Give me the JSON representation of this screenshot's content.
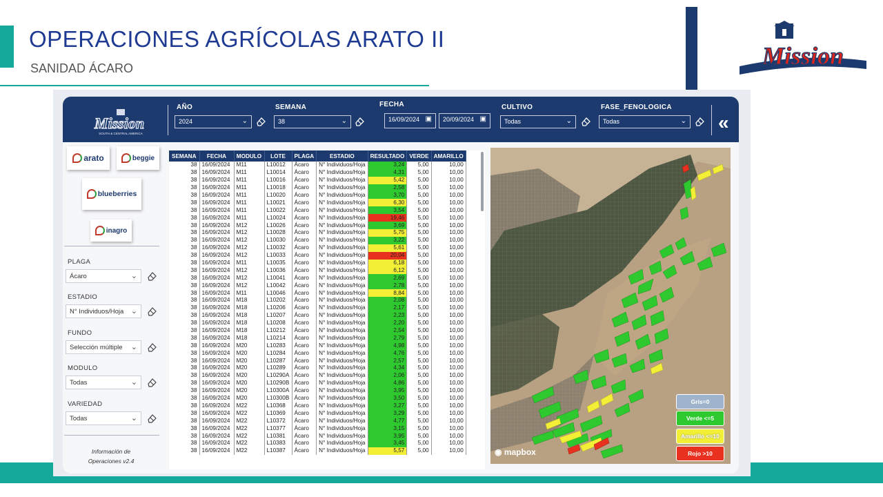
{
  "slide": {
    "title": "OPERACIONES AGRÍCOLAS ARATO II",
    "subtitle": "SANIDAD ÁCARO",
    "logo_text": "Mission",
    "colors": {
      "accent": "#14a99a",
      "title": "#1f3a93",
      "header": "#1d3a6e"
    }
  },
  "header": {
    "logo_text": "Mission",
    "logo_sub": "SOUTH & CENTRAL AMERICA",
    "filters": {
      "anio": {
        "label": "AÑO",
        "value": "2024"
      },
      "semana": {
        "label": "SEMANA",
        "value": "38"
      },
      "fecha": {
        "label": "FECHA",
        "from": "16/09/2024",
        "to": "20/09/2024"
      },
      "cultivo": {
        "label": "CULTIVO",
        "value": "Todas"
      },
      "fase": {
        "label": "FASE_FENOLOGICA",
        "value": "Todas"
      }
    },
    "collapse_icon": "«"
  },
  "left_panel": {
    "brands": [
      "arato",
      "beggie",
      "blueberries",
      "inagro"
    ],
    "filters": [
      {
        "label": "PLAGA",
        "value": "Ácaro"
      },
      {
        "label": "ESTADIO",
        "value": "N° Individuos/Hoja"
      },
      {
        "label": "FUNDO",
        "value": "Selección múltiple"
      },
      {
        "label": "MODULO",
        "value": "Todas"
      },
      {
        "label": "VARIEDAD",
        "value": "Todas"
      }
    ],
    "info_line1": "Información de",
    "info_line2": "Operaciones v2.4"
  },
  "table": {
    "columns": [
      "SEMANA",
      "FECHA",
      "MODULO",
      "LOTE",
      "PLAGA",
      "ESTADIO",
      "RESULTADO",
      "VERDE",
      "AMARILLO"
    ],
    "rows": [
      [
        "38",
        "16/09/2024",
        "M11",
        "L10012",
        "Ácaro",
        "N° Individuos/Hoja",
        "3,24",
        "5,00",
        "10,00",
        "g"
      ],
      [
        "38",
        "16/09/2024",
        "M11",
        "L10014",
        "Ácaro",
        "N° Individuos/Hoja",
        "4,31",
        "5,00",
        "10,00",
        "g"
      ],
      [
        "38",
        "16/09/2024",
        "M11",
        "L10016",
        "Ácaro",
        "N° Individuos/Hoja",
        "5,42",
        "5,00",
        "10,00",
        "y"
      ],
      [
        "38",
        "16/09/2024",
        "M11",
        "L10018",
        "Ácaro",
        "N° Individuos/Hoja",
        "2,58",
        "5,00",
        "10,00",
        "g"
      ],
      [
        "38",
        "16/09/2024",
        "M11",
        "L10020",
        "Ácaro",
        "N° Individuos/Hoja",
        "3,70",
        "5,00",
        "10,00",
        "g"
      ],
      [
        "38",
        "16/09/2024",
        "M11",
        "L10021",
        "Ácaro",
        "N° Individuos/Hoja",
        "6,30",
        "5,00",
        "10,00",
        "y"
      ],
      [
        "38",
        "16/09/2024",
        "M11",
        "L10022",
        "Ácaro",
        "N° Individuos/Hoja",
        "3,54",
        "5,00",
        "10,00",
        "g"
      ],
      [
        "38",
        "16/09/2024",
        "M11",
        "L10024",
        "Ácaro",
        "N° Individuos/Hoja",
        "19,46",
        "5,00",
        "10,00",
        "r"
      ],
      [
        "38",
        "16/09/2024",
        "M12",
        "L10026",
        "Ácaro",
        "N° Individuos/Hoja",
        "3,69",
        "5,00",
        "10,00",
        "g"
      ],
      [
        "38",
        "16/09/2024",
        "M12",
        "L10028",
        "Ácaro",
        "N° Individuos/Hoja",
        "5,75",
        "5,00",
        "10,00",
        "y"
      ],
      [
        "38",
        "16/09/2024",
        "M12",
        "L10030",
        "Ácaro",
        "N° Individuos/Hoja",
        "3,22",
        "5,00",
        "10,00",
        "g"
      ],
      [
        "38",
        "16/09/2024",
        "M12",
        "L10032",
        "Ácaro",
        "N° Individuos/Hoja",
        "5,61",
        "5,00",
        "10,00",
        "y"
      ],
      [
        "38",
        "16/09/2024",
        "M12",
        "L10033",
        "Ácaro",
        "N° Individuos/Hoja",
        "20,04",
        "5,00",
        "10,00",
        "r"
      ],
      [
        "38",
        "16/09/2024",
        "M11",
        "L10035",
        "Ácaro",
        "N° Individuos/Hoja",
        "6,18",
        "5,00",
        "10,00",
        "y"
      ],
      [
        "38",
        "16/09/2024",
        "M12",
        "L10036",
        "Ácaro",
        "N° Individuos/Hoja",
        "6,12",
        "5,00",
        "10,00",
        "y"
      ],
      [
        "38",
        "16/09/2024",
        "M12",
        "L10041",
        "Ácaro",
        "N° Individuos/Hoja",
        "2,69",
        "5,00",
        "10,00",
        "g"
      ],
      [
        "38",
        "16/09/2024",
        "M12",
        "L10042",
        "Ácaro",
        "N° Individuos/Hoja",
        "2,78",
        "5,00",
        "10,00",
        "g"
      ],
      [
        "38",
        "16/09/2024",
        "M11",
        "L10046",
        "Ácaro",
        "N° Individuos/Hoja",
        "8,84",
        "5,00",
        "10,00",
        "y"
      ],
      [
        "38",
        "16/09/2024",
        "M18",
        "L10202",
        "Ácaro",
        "N° Individuos/Hoja",
        "2,08",
        "5,00",
        "10,00",
        "g"
      ],
      [
        "38",
        "16/09/2024",
        "M18",
        "L10206",
        "Ácaro",
        "N° Individuos/Hoja",
        "2,17",
        "5,00",
        "10,00",
        "g"
      ],
      [
        "38",
        "16/09/2024",
        "M18",
        "L10207",
        "Ácaro",
        "N° Individuos/Hoja",
        "2,23",
        "5,00",
        "10,00",
        "g"
      ],
      [
        "38",
        "16/09/2024",
        "M18",
        "L10208",
        "Ácaro",
        "N° Individuos/Hoja",
        "2,20",
        "5,00",
        "10,00",
        "g"
      ],
      [
        "38",
        "16/09/2024",
        "M18",
        "L10212",
        "Ácaro",
        "N° Individuos/Hoja",
        "2,54",
        "5,00",
        "10,00",
        "g"
      ],
      [
        "38",
        "16/09/2024",
        "M18",
        "L10214",
        "Ácaro",
        "N° Individuos/Hoja",
        "2,79",
        "5,00",
        "10,00",
        "g"
      ],
      [
        "38",
        "16/09/2024",
        "M20",
        "L10283",
        "Ácaro",
        "N° Individuos/Hoja",
        "4,98",
        "5,00",
        "10,00",
        "g"
      ],
      [
        "38",
        "16/09/2024",
        "M20",
        "L10284",
        "Ácaro",
        "N° Individuos/Hoja",
        "4,76",
        "5,00",
        "10,00",
        "g"
      ],
      [
        "38",
        "16/09/2024",
        "M20",
        "L10287",
        "Ácaro",
        "N° Individuos/Hoja",
        "2,57",
        "5,00",
        "10,00",
        "g"
      ],
      [
        "38",
        "16/09/2024",
        "M20",
        "L10289",
        "Ácaro",
        "N° Individuos/Hoja",
        "4,34",
        "5,00",
        "10,00",
        "g"
      ],
      [
        "38",
        "16/09/2024",
        "M20",
        "L10290A",
        "Ácaro",
        "N° Individuos/Hoja",
        "2,06",
        "5,00",
        "10,00",
        "g"
      ],
      [
        "38",
        "16/09/2024",
        "M20",
        "L10290B",
        "Ácaro",
        "N° Individuos/Hoja",
        "4,86",
        "5,00",
        "10,00",
        "g"
      ],
      [
        "38",
        "16/09/2024",
        "M20",
        "L10300A",
        "Ácaro",
        "N° Individuos/Hoja",
        "3,95",
        "5,00",
        "10,00",
        "g"
      ],
      [
        "38",
        "16/09/2024",
        "M20",
        "L10300B",
        "Ácaro",
        "N° Individuos/Hoja",
        "3,50",
        "5,00",
        "10,00",
        "g"
      ],
      [
        "38",
        "16/09/2024",
        "M22",
        "L10368",
        "Ácaro",
        "N° Individuos/Hoja",
        "3,27",
        "5,00",
        "10,00",
        "g"
      ],
      [
        "38",
        "16/09/2024",
        "M22",
        "L10369",
        "Ácaro",
        "N° Individuos/Hoja",
        "3,29",
        "5,00",
        "10,00",
        "g"
      ],
      [
        "38",
        "16/09/2024",
        "M22",
        "L10372",
        "Ácaro",
        "N° Individuos/Hoja",
        "4,77",
        "5,00",
        "10,00",
        "g"
      ],
      [
        "38",
        "16/09/2024",
        "M22",
        "L10377",
        "Ácaro",
        "N° Individuos/Hoja",
        "3,15",
        "5,00",
        "10,00",
        "g"
      ],
      [
        "38",
        "16/09/2024",
        "M22",
        "L10381",
        "Ácaro",
        "N° Individuos/Hoja",
        "3,95",
        "5,00",
        "10,00",
        "g"
      ],
      [
        "38",
        "16/09/2024",
        "M22",
        "L10383",
        "Ácaro",
        "N° Individuos/Hoja",
        "3,45",
        "5,00",
        "10,00",
        "g"
      ],
      [
        "38",
        "16/09/2024",
        "M22",
        "L10387",
        "Ácaro",
        "N° Individuos/Hoja",
        "5,57",
        "5,00",
        "10,00",
        "y"
      ]
    ],
    "status_colors": {
      "g": "#2ec92e",
      "y": "#f2ef36",
      "r": "#e8311f"
    }
  },
  "map": {
    "attribution": "mapbox",
    "legend": [
      {
        "label": "Gris=0",
        "color": "#9fb4cc"
      },
      {
        "label": "Verde <=5",
        "color": "#2ec92e"
      },
      {
        "label": "Amarillo <=10",
        "color": "#f2ef36"
      },
      {
        "label": "Rojo >10",
        "color": "#e8311f"
      }
    ]
  }
}
